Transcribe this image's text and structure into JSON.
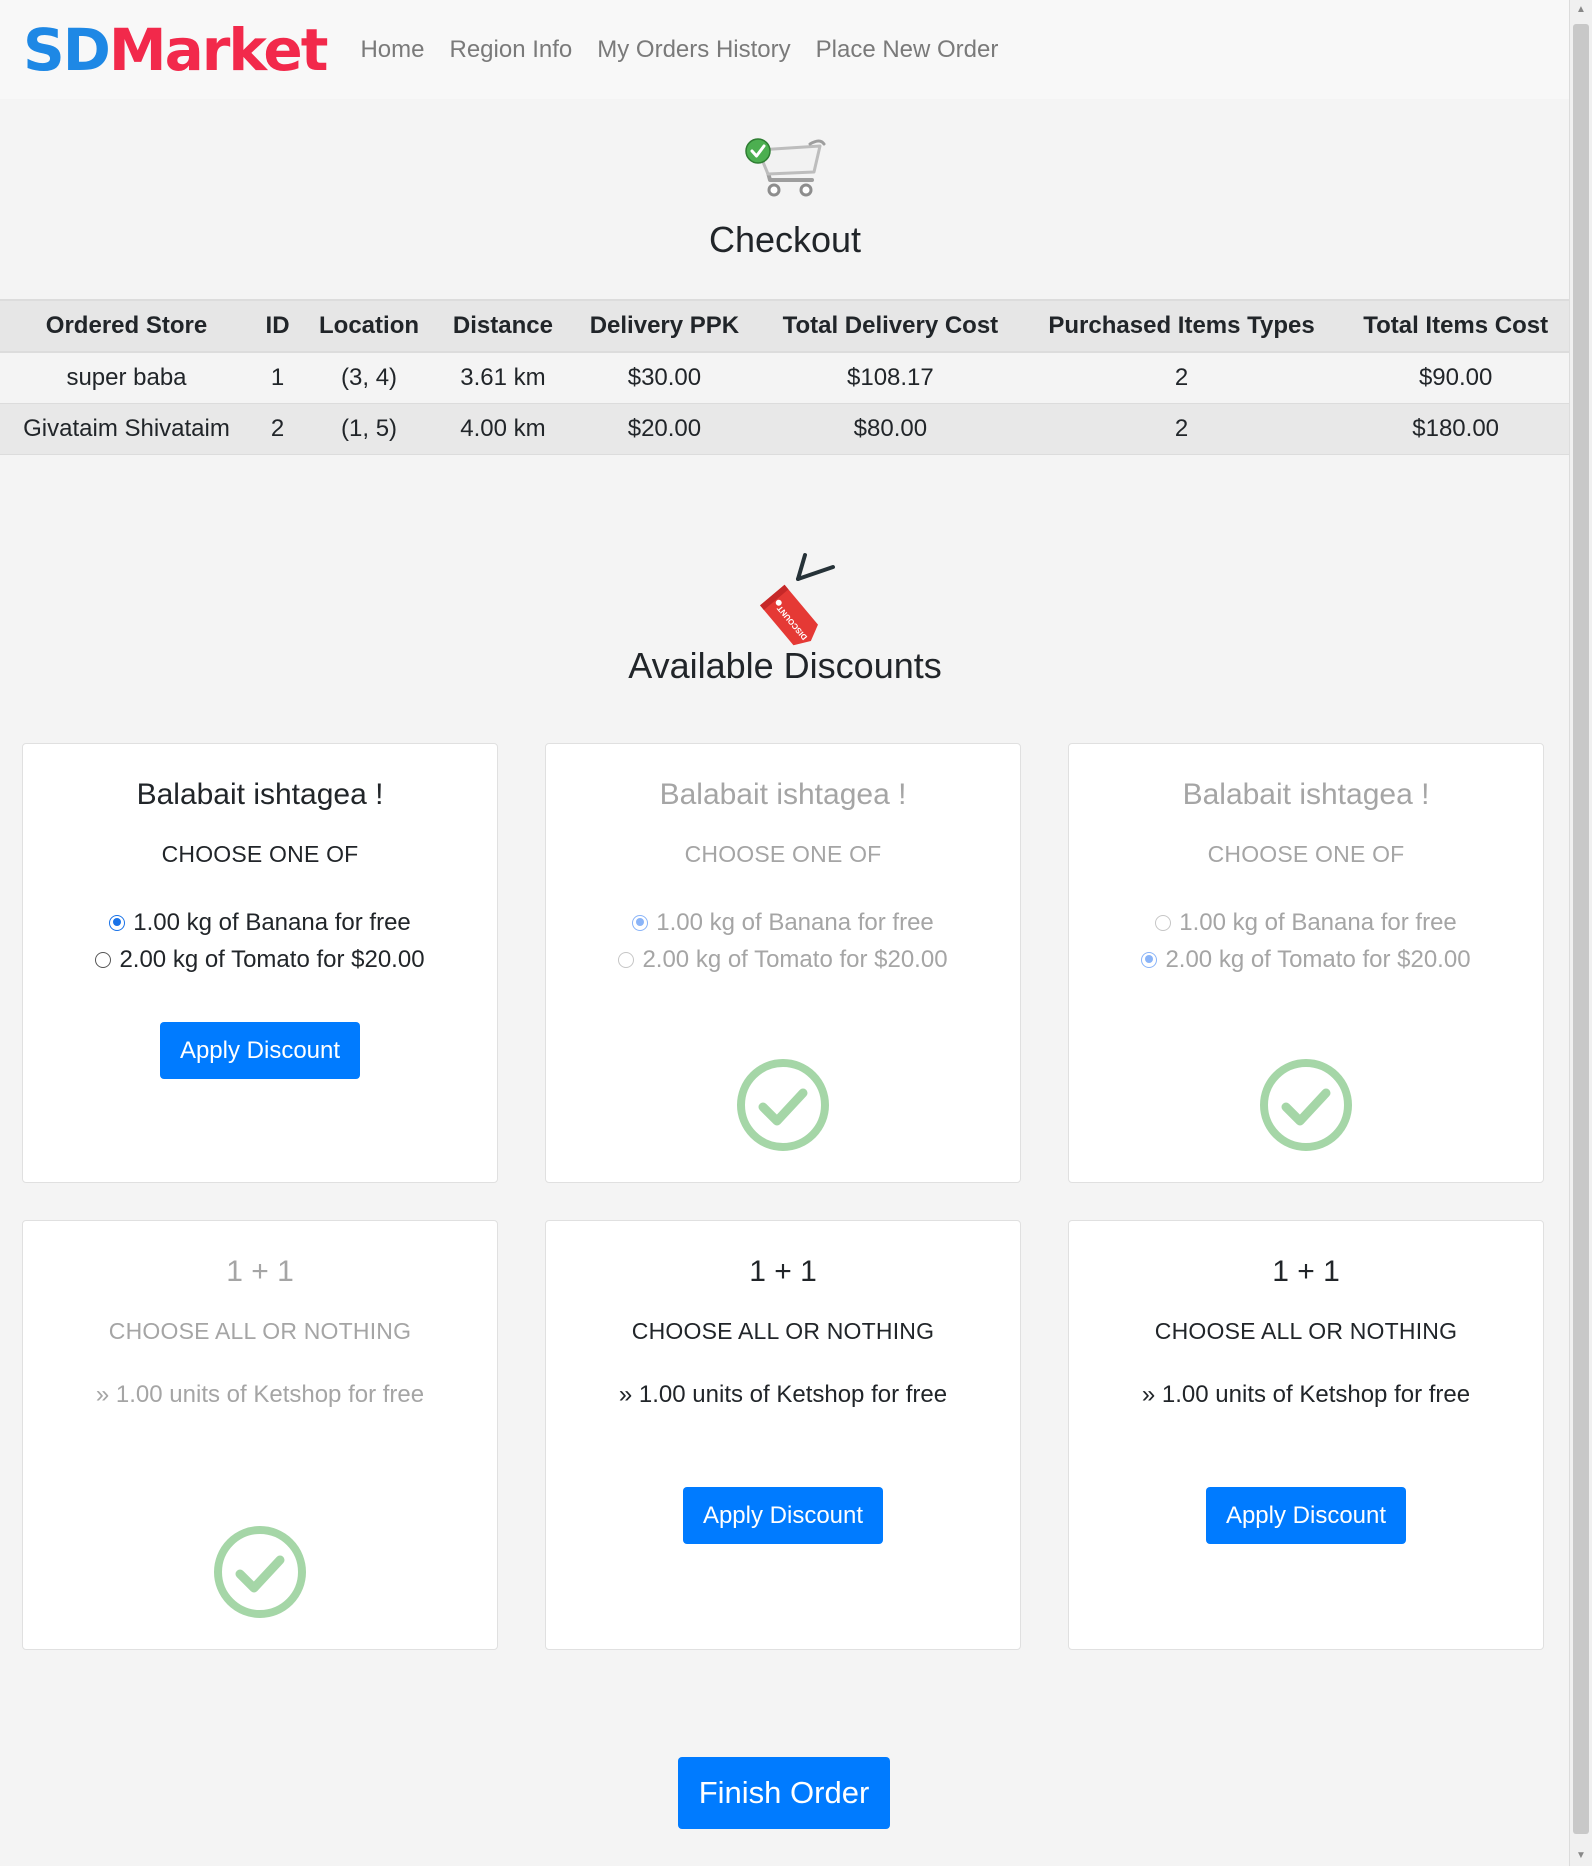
{
  "navbar": {
    "logo_part1": "SD",
    "logo_part2": "Market",
    "links": [
      "Home",
      "Region Info",
      "My Orders History",
      "Place New Order"
    ]
  },
  "checkout": {
    "title": "Checkout",
    "table": {
      "headers": [
        "Ordered Store",
        "ID",
        "Location",
        "Distance",
        "Delivery PPK",
        "Total Delivery Cost",
        "Purchased Items Types",
        "Total Items Cost"
      ],
      "rows": [
        [
          "super baba",
          "1",
          "(3, 4)",
          "3.61 km",
          "$30.00",
          "$108.17",
          "2",
          "$90.00"
        ],
        [
          "Givataim Shivataim",
          "2",
          "(1, 5)",
          "4.00 km",
          "$20.00",
          "$80.00",
          "2",
          "$180.00"
        ]
      ]
    }
  },
  "discounts": {
    "title": "Available Discounts",
    "tag_text": "DISCOUNT",
    "cards": [
      {
        "title": "Balabait ishtagea !",
        "type": "CHOOSE ONE OF",
        "options": [
          "1.00 kg of Banana for free",
          "2.00 kg of Tomato for $20.00"
        ],
        "selected": 0,
        "applied": false,
        "button": "Apply Discount"
      },
      {
        "title": "Balabait ishtagea !",
        "type": "CHOOSE ONE OF",
        "options": [
          "1.00 kg of Banana for free",
          "2.00 kg of Tomato for $20.00"
        ],
        "selected": 0,
        "applied": true
      },
      {
        "title": "Balabait ishtagea !",
        "type": "CHOOSE ONE OF",
        "options": [
          "1.00 kg of Banana for free",
          "2.00 kg of Tomato for $20.00"
        ],
        "selected": 1,
        "applied": true
      },
      {
        "title": "1 + 1",
        "type": "CHOOSE ALL OR NOTHING",
        "item": "» 1.00 units of Ketshop for free",
        "applied": true
      },
      {
        "title": "1 + 1",
        "type": "CHOOSE ALL OR NOTHING",
        "item": "» 1.00 units of Ketshop for free",
        "applied": false,
        "button": "Apply Discount"
      },
      {
        "title": "1 + 1",
        "type": "CHOOSE ALL OR NOTHING",
        "item": "» 1.00 units of Ketshop for free",
        "applied": false,
        "button": "Apply Discount"
      }
    ]
  },
  "finish_button": "Finish Order",
  "colors": {
    "primary": "#007bff",
    "logo_blue": "#1e88e5",
    "logo_red": "#f2294b",
    "applied_check": "#a5d6a7",
    "tag_red": "#e53935"
  }
}
